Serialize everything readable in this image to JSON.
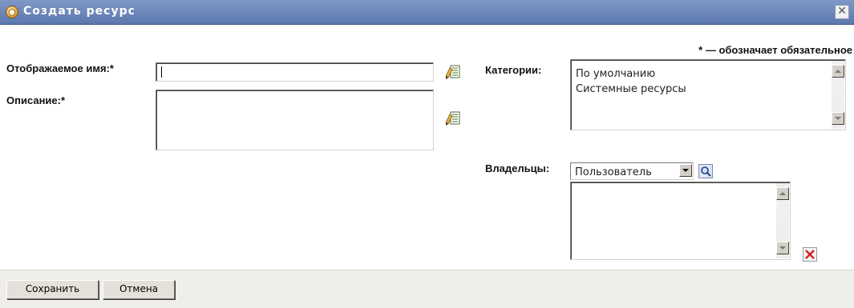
{
  "dialog": {
    "title": "Создать ресурс",
    "close_symbol": "✕",
    "required_note": "* — обозначает обязательное"
  },
  "form": {
    "display_name": {
      "label": "Отображаемое имя:*",
      "value": ""
    },
    "description": {
      "label": "Описание:*",
      "value": ""
    },
    "categories": {
      "label": "Категории:",
      "items": [
        "По умолчанию",
        "Системные ресурсы"
      ]
    },
    "owners": {
      "label": "Владельцы:",
      "type_select": "Пользователь",
      "items": []
    }
  },
  "footer": {
    "save_label": "Сохранить",
    "cancel_label": "Отмена"
  },
  "icons": {
    "title": "resource-icon",
    "edit": "localize-edit-icon",
    "search": "magnifier-icon",
    "remove": "delete-x-icon"
  },
  "colors": {
    "titlebar": "#6a86bb",
    "footer": "#f0eeea",
    "remove_red": "#d42020"
  }
}
